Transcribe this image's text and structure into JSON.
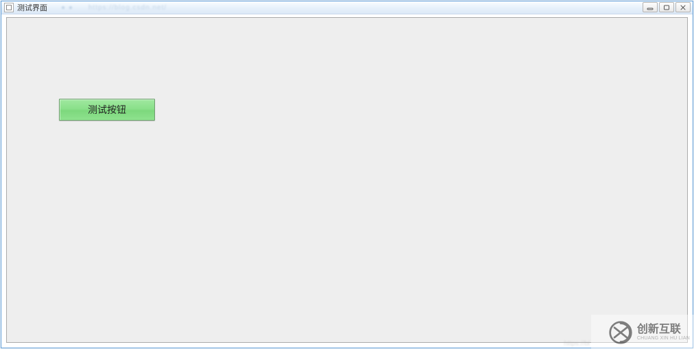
{
  "window": {
    "title": "测试界面"
  },
  "main": {
    "test_button_label": "测试按钮"
  },
  "watermark": {
    "brand_main": "创新互联",
    "brand_sub": "CHUANG XIN HU LIAN"
  }
}
